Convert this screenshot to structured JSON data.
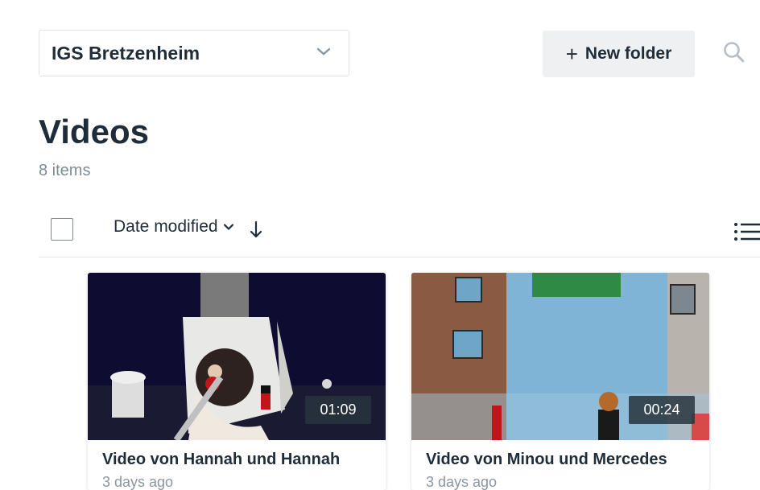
{
  "workspace": {
    "name": "IGS Bretzenheim"
  },
  "toolbar": {
    "new_folder_label": "New folder"
  },
  "page": {
    "title": "Videos",
    "item_count": "8 items"
  },
  "sort": {
    "label": "Date modified"
  },
  "videos": [
    {
      "title": "Video von Hannah und Hannah",
      "duration": "01:09",
      "modified": "3 days ago"
    },
    {
      "title": "Video von Minou und Mercedes",
      "duration": "00:24",
      "modified": "3 days ago"
    }
  ],
  "colors": {
    "text": "#1f2d3a",
    "muted": "#7d8b99",
    "button_bg": "#eef0f2",
    "border": "#dfe3e7"
  },
  "icons": [
    "chevron-down-icon",
    "plus-icon",
    "search-icon",
    "arrow-down-icon",
    "list-view-icon"
  ]
}
